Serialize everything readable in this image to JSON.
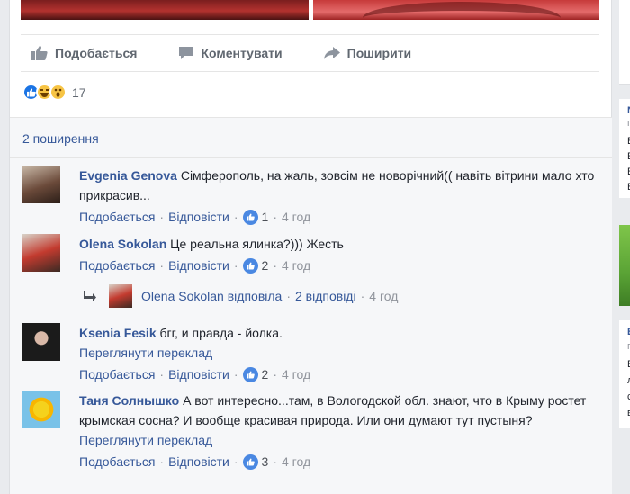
{
  "actions": {
    "like": "Подобається",
    "comment": "Коментувати",
    "share": "Поширити"
  },
  "reactions": {
    "count": "17",
    "types": [
      "like-icon",
      "haha-icon",
      "wow-icon"
    ]
  },
  "shares": {
    "label": "2 поширення"
  },
  "comments": [
    {
      "author": "Evgenia Genova",
      "text": "Сімферополь, на жаль, зовсім не новорічний(( навіть вітрини мало хто прикрасив...",
      "like_label": "Подобається",
      "reply_label": "Відповісти",
      "likes": "1",
      "time": "4 год"
    },
    {
      "author": "Olena Sokolan",
      "text": "Це реальна ялинка?))) Жесть",
      "like_label": "Подобається",
      "reply_label": "Відповісти",
      "likes": "2",
      "time": "4 год",
      "replies": {
        "who": "Olena Sokolan",
        "action": "відповіла",
        "count_label": "2 відповіді",
        "time": "4 год"
      }
    },
    {
      "author": "Ksenia Fesik",
      "text": "бгг, и правда - йолка.",
      "translate": "Переглянути переклад",
      "like_label": "Подобається",
      "reply_label": "Відповісти",
      "likes": "2",
      "time": "4 год"
    },
    {
      "author": "Таня Солнышко",
      "text": "А вот интересно...там, в Вологодской обл. знают, что в Крыму ростет крымская сосна? И вообще красивая природа. Или они думают тут пустыня?",
      "translate": "Переглянути переклад",
      "like_label": "Подобається",
      "reply_label": "Відповісти",
      "likes": "3",
      "time": "4 год"
    }
  ],
  "sidebar_fragments": {
    "a": [
      "N",
      "п",
      "B",
      "E",
      "E",
      "B"
    ],
    "b": [
      "E",
      "п",
      "B",
      "л",
      "c",
      "в"
    ]
  },
  "colors": {
    "link": "#365899",
    "muted": "#90949c",
    "like_blue": "#4a88e2",
    "background": "#e9ebee"
  }
}
